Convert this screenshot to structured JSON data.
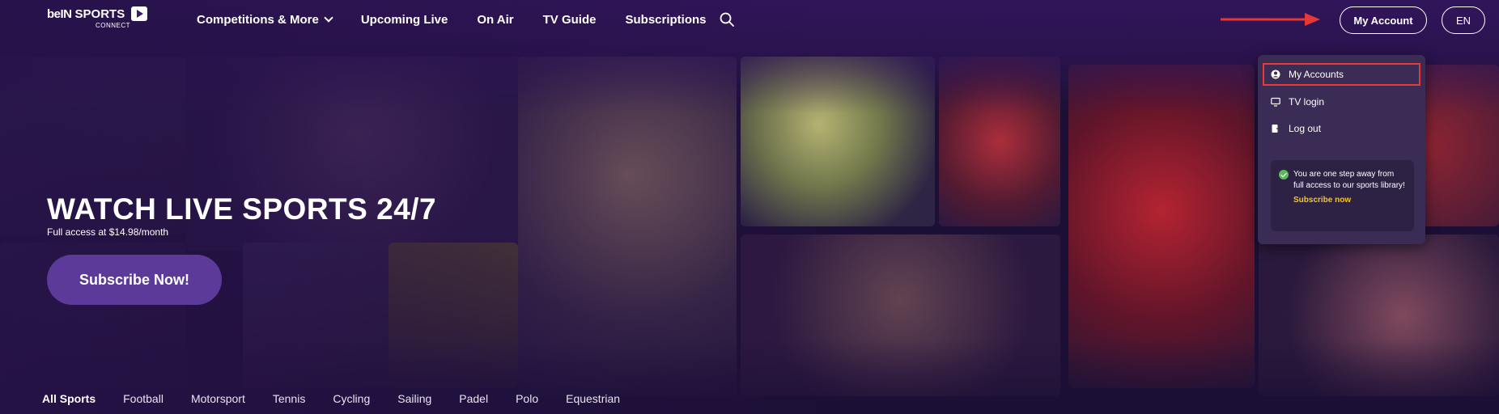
{
  "logo": {
    "brand": "beIN",
    "sports": "SPORTS",
    "sub": "CONNECT"
  },
  "nav": {
    "items": [
      {
        "label": "Competitions & More",
        "has_dropdown": true
      },
      {
        "label": "Upcoming Live"
      },
      {
        "label": "On Air"
      },
      {
        "label": "TV Guide"
      },
      {
        "label": "Subscriptions"
      }
    ],
    "search_icon": "search-icon"
  },
  "header": {
    "account_button": "My Account",
    "language_button": "EN"
  },
  "dropdown": {
    "items": [
      {
        "label": "My Accounts",
        "icon": "account-icon",
        "highlighted": true
      },
      {
        "label": "TV login",
        "icon": "tv-icon"
      },
      {
        "label": "Log out",
        "icon": "logout-icon"
      }
    ],
    "promo": {
      "text": "You are one step away from full access to our sports library!",
      "link": "Subscribe now"
    }
  },
  "hero": {
    "title": "WATCH LIVE SPORTS 24/7",
    "subtitle": "Full access at $14.98/month",
    "cta": "Subscribe Now!"
  },
  "sport_tabs": [
    "All Sports",
    "Football",
    "Motorsport",
    "Tennis",
    "Cycling",
    "Sailing",
    "Padel",
    "Polo",
    "Equestrian"
  ],
  "colors": {
    "background": "#1b0f33",
    "cta": "#5b3a99",
    "dropdown": "#3a2c55",
    "highlight_box": "#e53935",
    "annotation_arrow": "#e53935",
    "promo_link": "#f5c518"
  }
}
